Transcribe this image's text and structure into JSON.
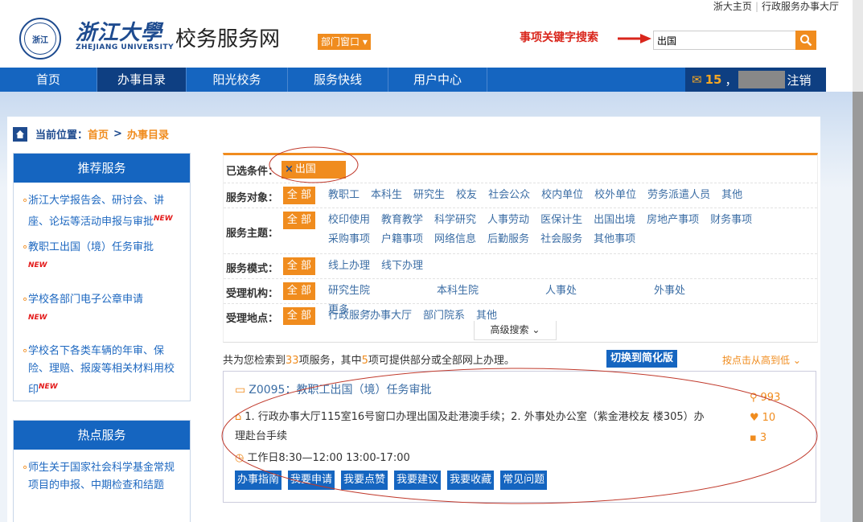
{
  "top_links": [
    "浙大主页",
    "行政服务办事大厅"
  ],
  "header": {
    "logo_cn": "浙江大學",
    "logo_en": "ZHEJIANG UNIVERSITY",
    "site_title": "校务服务网",
    "dept_window": "部门窗口",
    "search_label": "事项关键字搜索",
    "search_value": "出国"
  },
  "nav": {
    "items": [
      "首页",
      "办事目录",
      "阳光校务",
      "服务快线",
      "用户中心"
    ],
    "active": "办事目录",
    "mail_count": "15",
    "mail_sep": "，",
    "logout": "注销"
  },
  "breadcrumb": {
    "label": "当前位置：",
    "home": "首页",
    "sep": ">",
    "current": "办事目录"
  },
  "sidebar": {
    "recommended": {
      "title": "推荐服务",
      "items": [
        {
          "text": "浙江大学报告会、研讨会、讲座、论坛等活动申报与审批",
          "new": "NEW"
        },
        {
          "text": "教职工出国（境）任务审批",
          "new": "NEW"
        },
        {
          "text": "学校各部门电子公章申请",
          "new": "NEW"
        },
        {
          "text": "学校名下各类车辆的年审、保险、理赔、报废等相关材料用校印",
          "new": "NEW"
        }
      ]
    },
    "hot": {
      "title": "热点服务",
      "items": [
        {
          "text": "师生关于国家社会科学基金常规项目的申报、中期检查和结题"
        }
      ]
    }
  },
  "filter": {
    "selected_label": "已选条件：",
    "selected_tag": "出国",
    "all_label": "全 部",
    "rows": [
      {
        "label": "服务对象：",
        "options": [
          "教职工",
          "本科生",
          "研究生",
          "校友",
          "社会公众",
          "校内单位",
          "校外单位",
          "劳务派遣人员",
          "其他"
        ]
      },
      {
        "label": "服务主题：",
        "options": [
          "校印使用",
          "教育教学",
          "科学研究",
          "人事劳动",
          "医保计生",
          "出国出境",
          "房地产事项",
          "财务事项",
          "采购事项",
          "户籍事项",
          "网络信息",
          "后勤服务",
          "社会服务",
          "其他事项"
        ]
      },
      {
        "label": "服务模式：",
        "options": [
          "线上办理",
          "线下办理"
        ]
      },
      {
        "label": "受理机构：",
        "options": [
          "研究生院",
          "本科生院",
          "人事处",
          "外事处"
        ],
        "more": "更多"
      },
      {
        "label": "受理地点：",
        "options": [
          "行政服务办事大厅",
          "部门院系",
          "其他"
        ]
      }
    ],
    "advanced": "高级搜索"
  },
  "results": {
    "prefix": "共为您检索到",
    "count": "33",
    "mid": "项服务，其中",
    "online_count": "5",
    "suffix": "项可提供部分或全部网上办理。",
    "toggle": "切换到简化版",
    "sort": "按点击从高到低",
    "card": {
      "title": "Z0095：教职工出国（境）任务审批",
      "address": "1. 行政办事大厅115室16号窗口办理出国及赴港澳手续；2. 外事处办公室（紫金港校友 楼305）办理赴台手续",
      "hours": "工作日8:30—12:00 13:00-17:00",
      "views": "993",
      "likes": "10",
      "comments": "3",
      "buttons": [
        "办事指南",
        "我要申请",
        "我要点赞",
        "我要建议",
        "我要收藏",
        "常见问题"
      ]
    }
  },
  "colors": {
    "brand_blue": "#1565c0",
    "accent_orange": "#f08c1e",
    "alert_red": "#d9261c"
  }
}
